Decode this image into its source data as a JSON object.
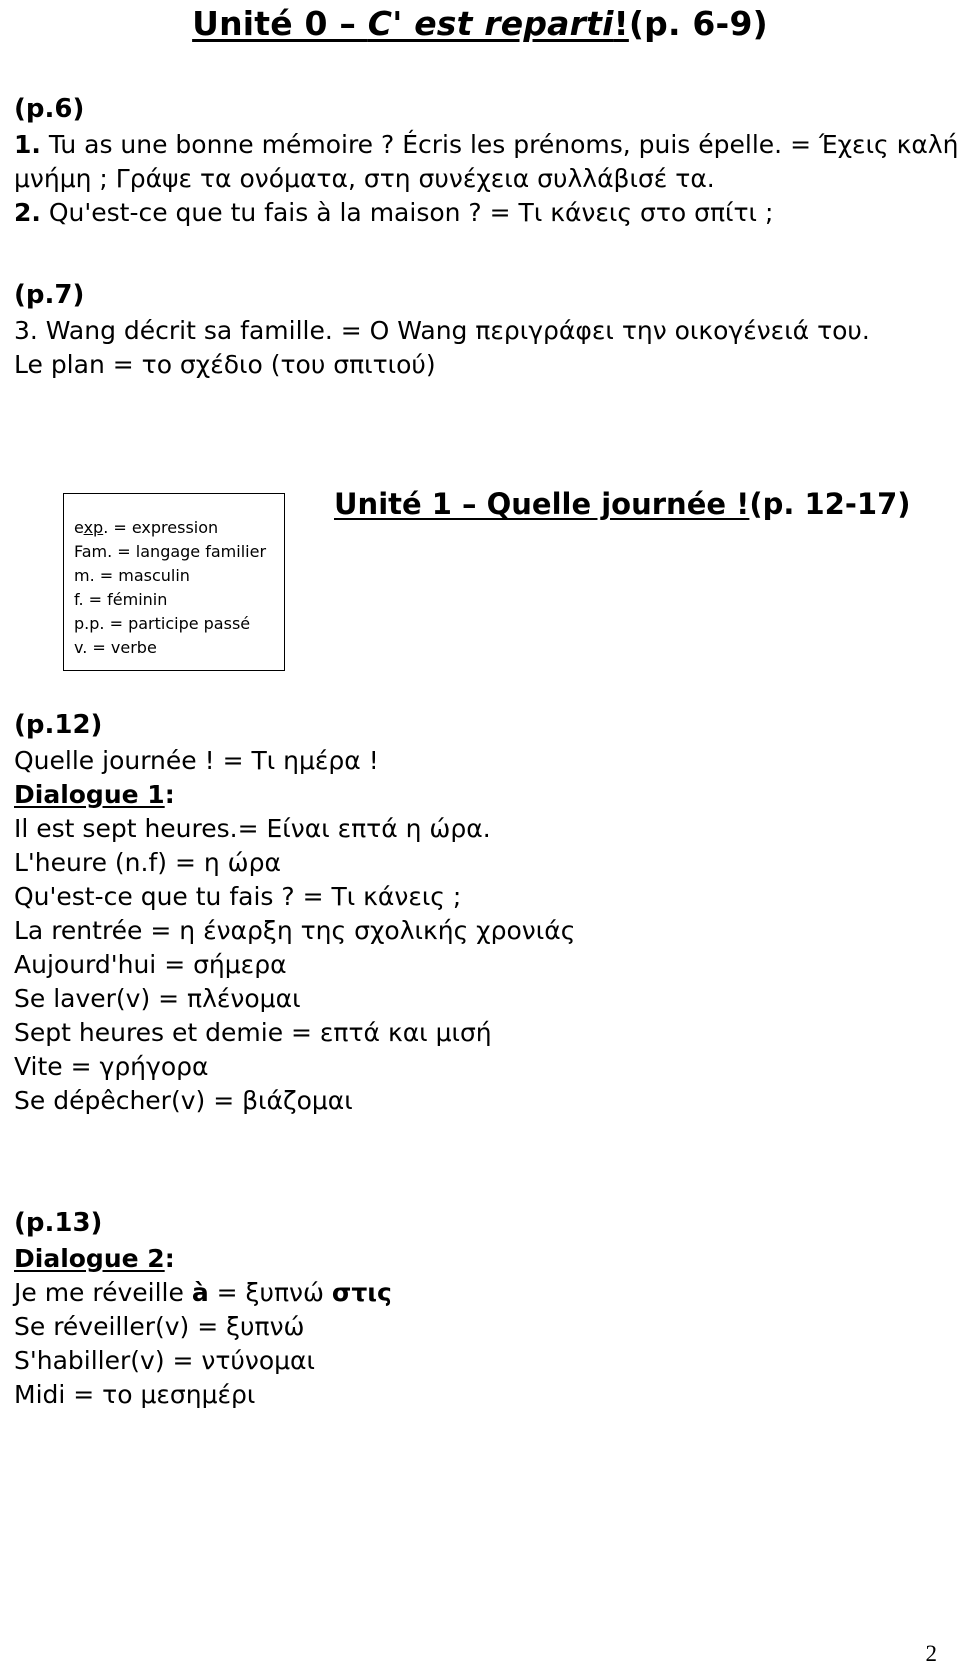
{
  "document": {
    "title_prefix": "Unité 0 – ",
    "title_italic": "C' est reparti",
    "title_bang": "!",
    "title_pages": "(p. 6-9)",
    "page_number": "2"
  },
  "sections": {
    "p6": {
      "label": "(p.6)",
      "items": [
        {
          "num": "1.",
          "text": " Tu as une bonne mémoire ? Écris les prénoms, puis épelle. = Έχεις καλή"
        },
        {
          "num": "",
          "text": "μνήμη ; Γράψε τα ονόματα, στη συνέχεια συλλάβισέ τα."
        },
        {
          "num": "2.",
          "text": " Qu'est-ce que tu fais à la maison ? = Τι κάνεις στο σπίτι ;"
        }
      ]
    },
    "p7": {
      "label": "(p.7)",
      "items": [
        {
          "num": "",
          "text": "3. Wang décrit sa famille. = Ο Wang περιγράφει την οικογένειά του."
        },
        {
          "num": "",
          "text": "Le plan = το σχέδιο (του σπιτιού)"
        }
      ]
    },
    "legend": {
      "lines": [
        {
          "abbr_pre": "e",
          "abbr_underlined": "xp",
          "abbr_post": ".",
          "rest": " = expression"
        },
        {
          "abbr_pre": "Fam.",
          "abbr_underlined": "",
          "abbr_post": "",
          "rest": " = langage familier"
        },
        {
          "abbr_pre": "m.",
          "abbr_underlined": "",
          "abbr_post": "",
          "rest": " = masculin"
        },
        {
          "abbr_pre": "f.",
          "abbr_underlined": "",
          "abbr_post": "",
          "rest": " = féminin"
        },
        {
          "abbr_pre": "p.p.",
          "abbr_underlined": "",
          "abbr_post": "",
          "rest": " = participe passé"
        },
        {
          "abbr_pre": "v.",
          "abbr_underlined": "",
          "abbr_post": "",
          "rest": " = verbe"
        }
      ]
    },
    "unit1": {
      "heading_underlined": "Unité 1 – Quelle journée !",
      "heading_pages": "(p. 12-17)"
    },
    "p12": {
      "label": "(p.12)",
      "intro": "Quelle journée ! = Τι ημέρα !",
      "dialogue_label": "Dialogue 1",
      "dialogue_colon": ":",
      "entries": [
        "Il est sept heures.= Είναι επτά η ώρα.",
        "L'heure (n.f)  = η ώρα",
        "Qu'est-ce que tu fais ? = Τι κάνεις ;",
        "La rentrée = η έναρξη της σχολικής χρονιάς",
        "Aujourd'hui = σήμερα",
        "Se laver(v) = πλένομαι",
        "Sept heures et demie = επτά και μισή",
        "Vite = γρήγορα",
        "Se dépêcher(v)  = βιάζομαι"
      ]
    },
    "p13": {
      "label": "(p.13)",
      "dialogue_label": "Dialogue 2",
      "dialogue_colon": ":",
      "first_entry": {
        "pre": "Je me réveille ",
        "bold_a": "à",
        "mid": " = ξυπνώ ",
        "bold_end": "στις"
      },
      "entries": [
        "Se réveiller(v)  = ξυπνώ",
        "S'habiller(v) = ντύνομαι",
        "Midi = το μεσημέρι"
      ]
    }
  }
}
